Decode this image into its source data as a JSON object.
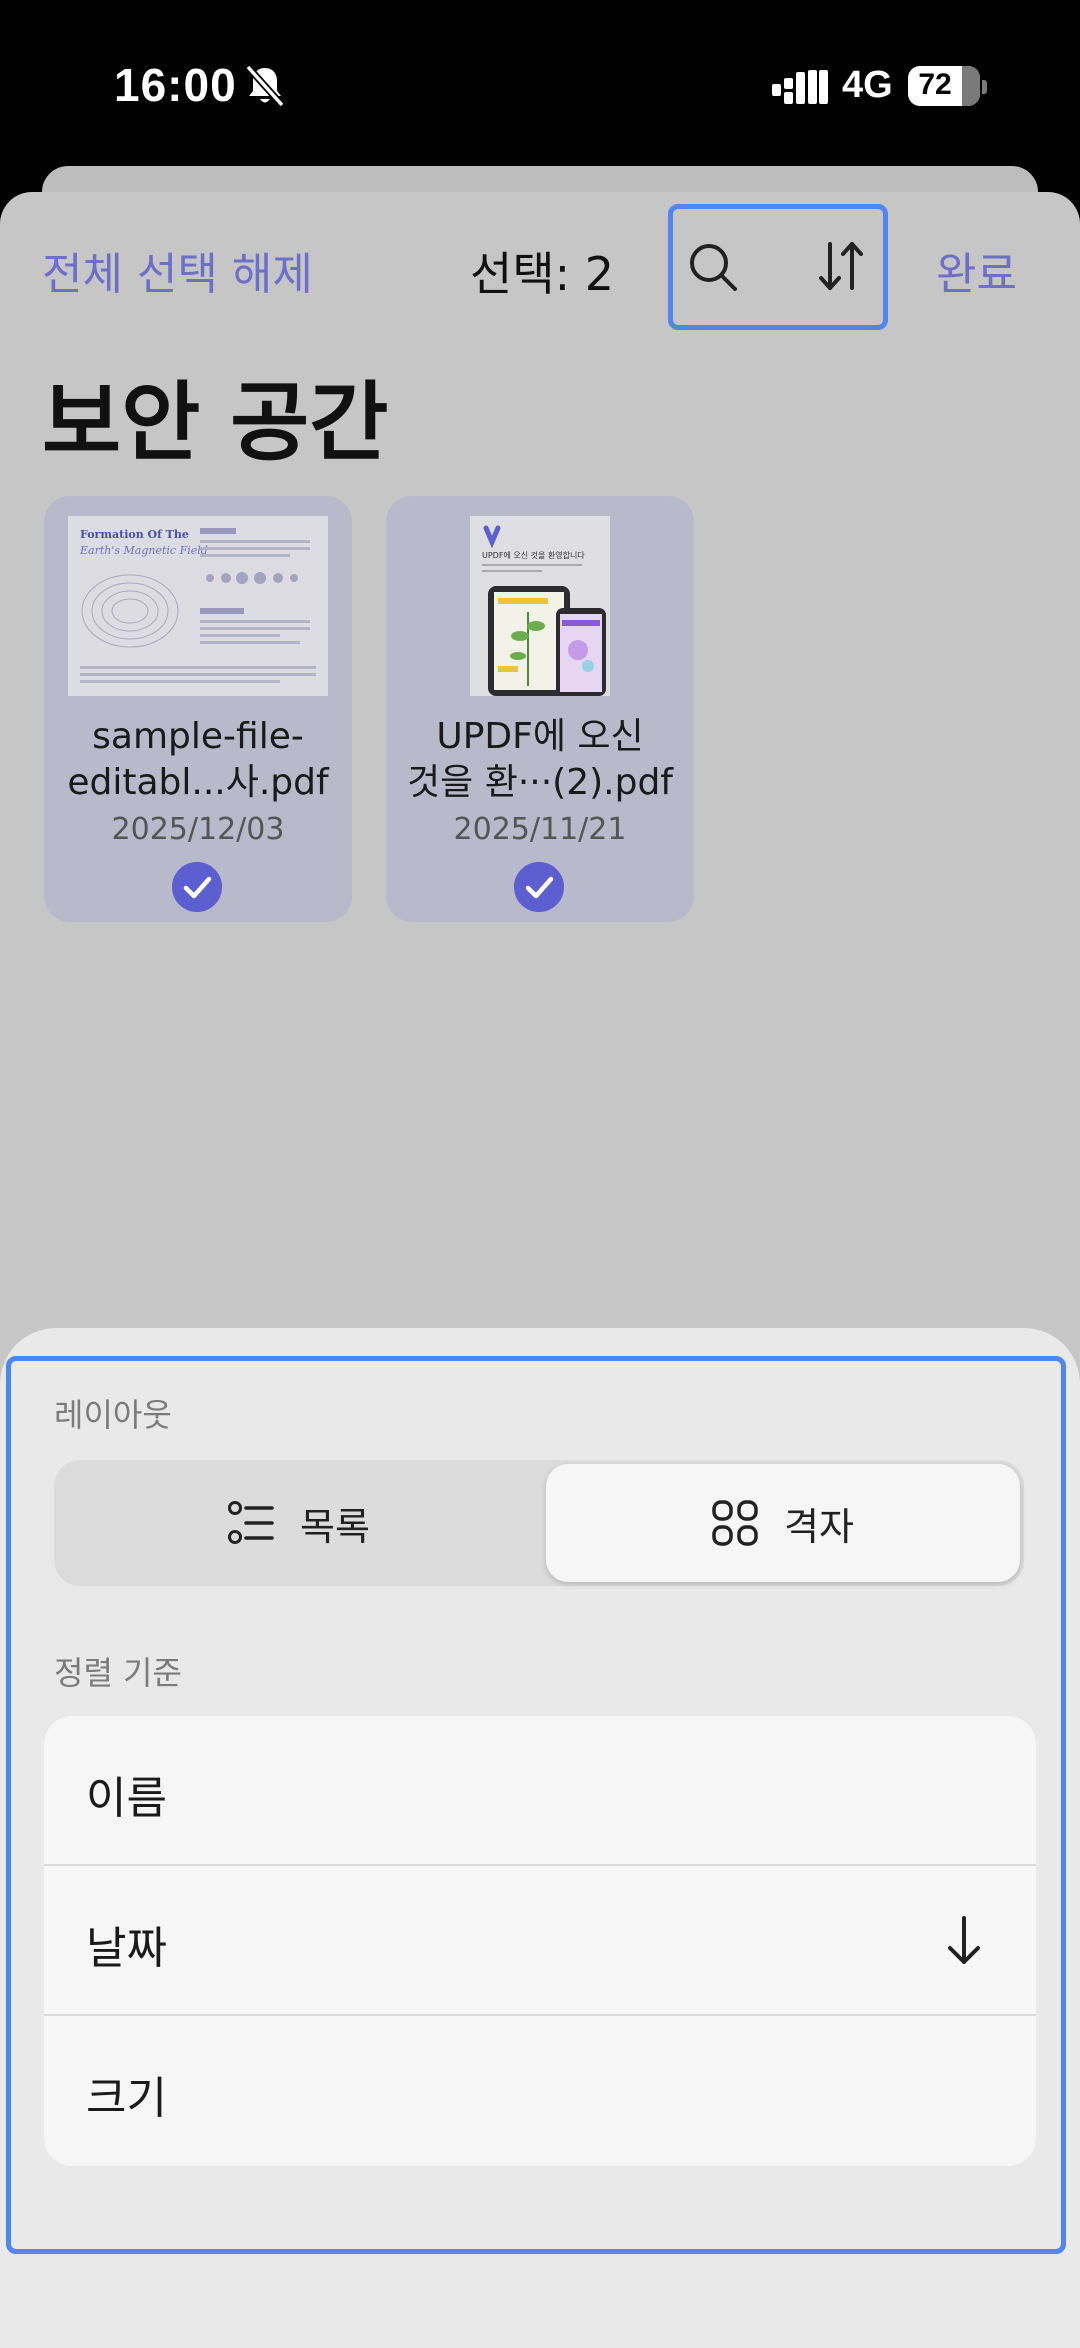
{
  "status_bar": {
    "time": "16:00",
    "network": "4G",
    "battery": "72",
    "battery_level": 0.72
  },
  "nav": {
    "deselect_all": "전체 선택 해제",
    "selection_count": "선택: 2",
    "done": "완료"
  },
  "page_title": "보안 공간",
  "files": [
    {
      "name": "sample-file-editabl...사.pdf",
      "name_line1": "sample-file-",
      "name_line2": "editabl...사.pdf",
      "date": "2025/12/03",
      "selected": true,
      "thumb_title_1": "Formation Of The",
      "thumb_title_2": "Earth's Magnetic Field"
    },
    {
      "name": "UPDF에 오신 것을 환···(2).pdf",
      "name_line1": "UPDF에 오신",
      "name_line2": "것을 환···(2).pdf",
      "date": "2025/11/21",
      "selected": true,
      "thumb_title_1": "UPDF에 오신 것을 환영합니다"
    }
  ],
  "bottom_sheet": {
    "layout_label": "레이아웃",
    "layout_options": [
      {
        "label": "목록",
        "icon": "list-icon",
        "selected": false
      },
      {
        "label": "격자",
        "icon": "grid-icon",
        "selected": true
      }
    ],
    "sort_label": "정렬 기준",
    "sort_options": [
      {
        "label": "이름",
        "active": false
      },
      {
        "label": "날짜",
        "active": true,
        "direction": "descending"
      },
      {
        "label": "크기",
        "active": false
      }
    ]
  },
  "colors": {
    "accent": "#6e6fc9",
    "highlight_frame": "#4f86f0",
    "check": "#5d5ecf"
  }
}
